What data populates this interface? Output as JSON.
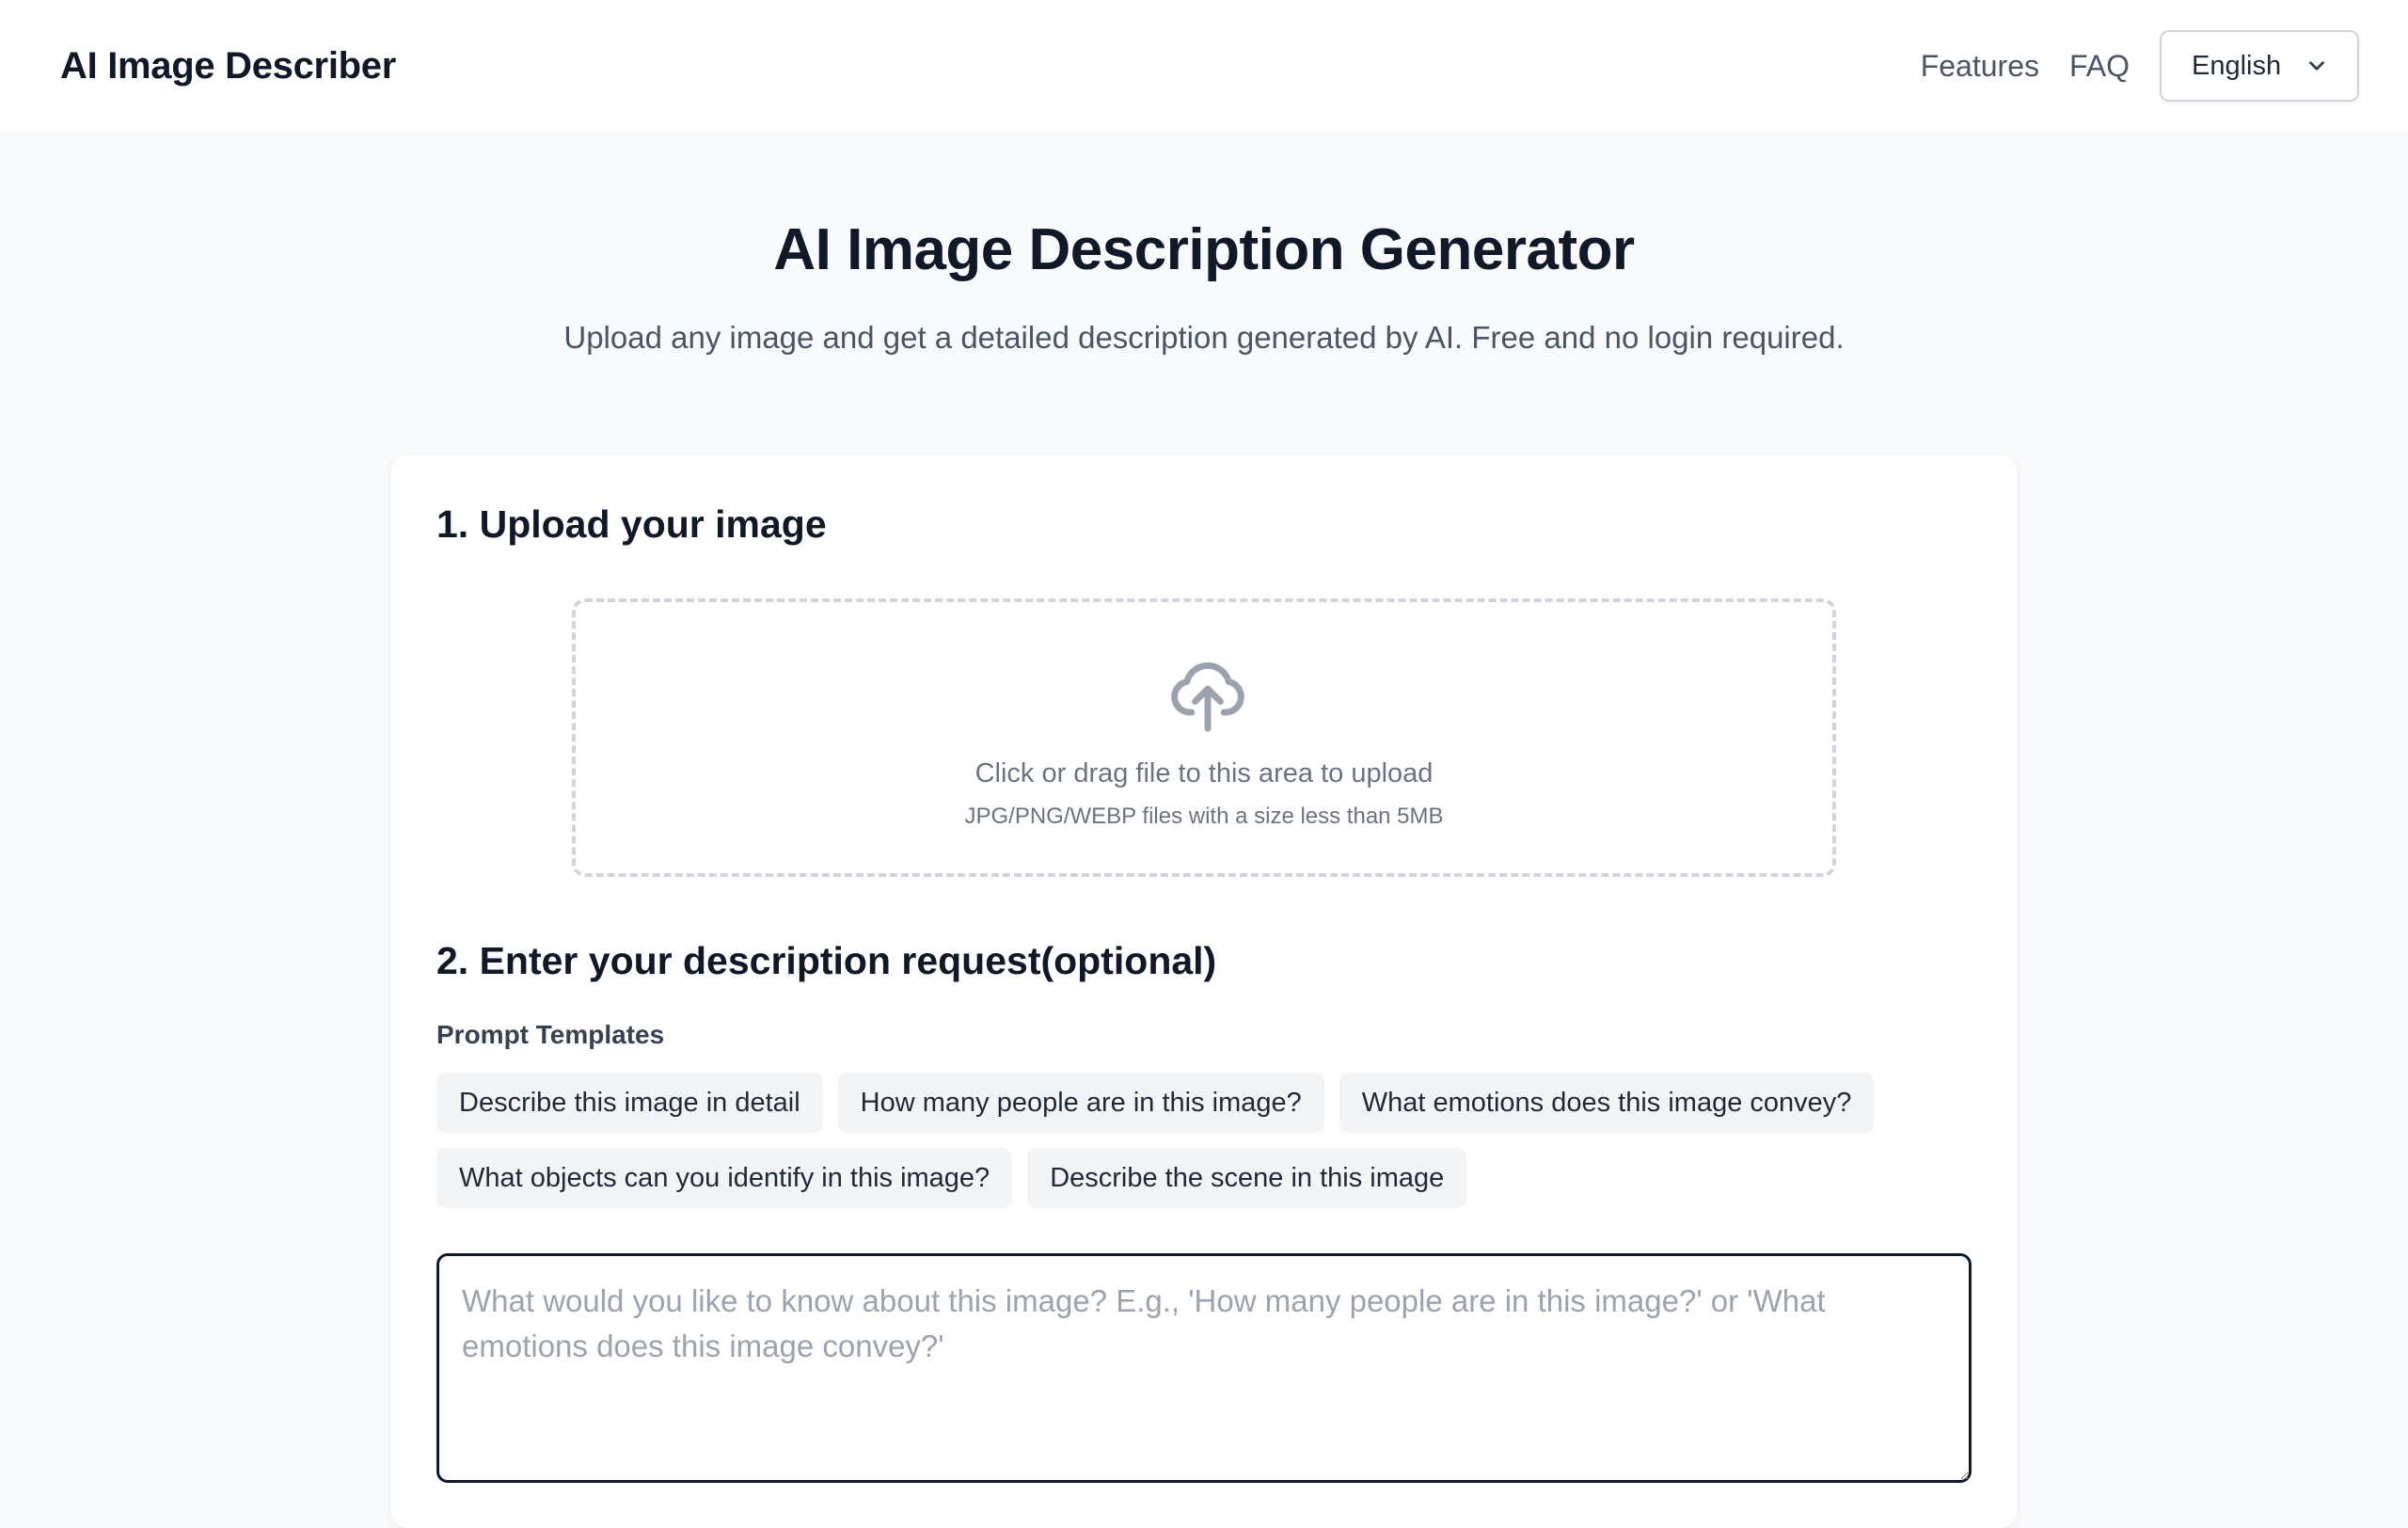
{
  "header": {
    "brand": "AI Image Describer",
    "nav": [
      "Features",
      "FAQ"
    ],
    "language": {
      "selected": "English",
      "icon": "chevron-down-icon"
    }
  },
  "hero": {
    "title": "AI Image Description Generator",
    "subtitle": "Upload any image and get a detailed description generated by AI. Free and no login required."
  },
  "upload": {
    "heading": "1. Upload your image",
    "icon": "cloud-upload-icon",
    "main_text": "Click or drag file to this area to upload",
    "hint": "JPG/PNG/WEBP files with a size less than 5MB"
  },
  "request": {
    "heading": "2. Enter your description request(optional)",
    "templates_label": "Prompt Templates",
    "templates": [
      "Describe this image in detail",
      "How many people are in this image?",
      "What emotions does this image convey?",
      "What objects can you identify in this image?",
      "Describe the scene in this image"
    ],
    "placeholder": "What would you like to know about this image? E.g., 'How many people are in this image?' or 'What emotions does this image convey?'",
    "value": ""
  },
  "colors": {
    "page_bg": "#f9fafb",
    "card_bg": "#ffffff",
    "text_primary": "#111827",
    "text_muted": "#6b7280",
    "chip_bg": "#f3f4f6",
    "dashed_border": "#d1d5db"
  }
}
